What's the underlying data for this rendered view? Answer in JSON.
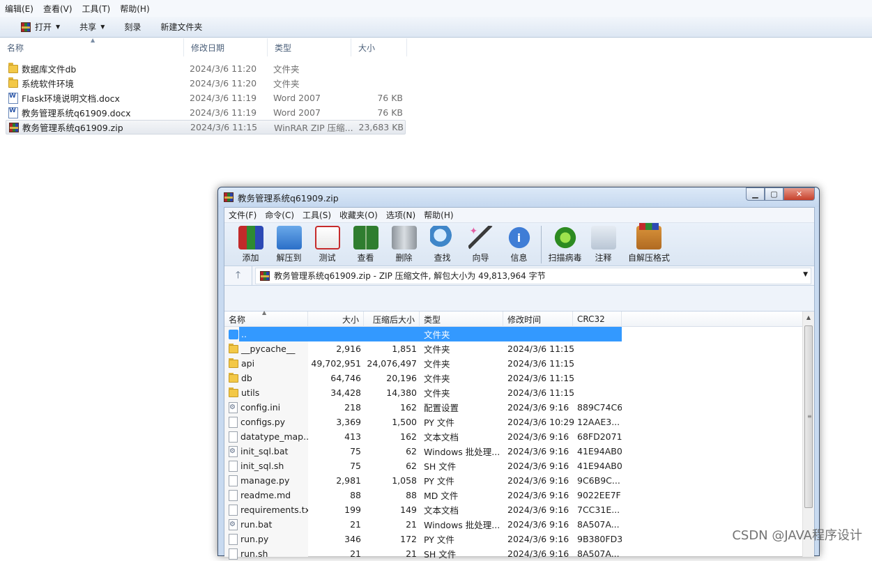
{
  "explorer": {
    "menu": [
      "编辑(E)",
      "查看(V)",
      "工具(T)",
      "帮助(H)"
    ],
    "toolbar": {
      "open": "打开",
      "share": "共享",
      "burn": "刻录",
      "new_folder": "新建文件夹"
    },
    "headers": {
      "name": "名称",
      "modified": "修改日期",
      "type": "类型",
      "size": "大小"
    },
    "rows": [
      {
        "icon": "folder-icon",
        "name": "数据库文件db",
        "date": "2024/3/6 11:20",
        "type": "文件夹",
        "size": ""
      },
      {
        "icon": "folder-icon",
        "name": "系统软件环境",
        "date": "2024/3/6 11:20",
        "type": "文件夹",
        "size": ""
      },
      {
        "icon": "word-doc-icon",
        "name": "Flask环境说明文档.docx",
        "date": "2024/3/6 11:19",
        "type": "Word 2007",
        "size": "76 KB"
      },
      {
        "icon": "word-doc-icon",
        "name": "教务管理系统q61909.docx",
        "date": "2024/3/6 11:19",
        "type": "Word 2007",
        "size": "76 KB"
      },
      {
        "icon": "winrar-archive-icon",
        "name": "教务管理系统q61909.zip",
        "date": "2024/3/6 11:15",
        "type": "WinRAR ZIP 压缩...",
        "size": "23,683 KB"
      }
    ],
    "selected_row": 4
  },
  "winrar": {
    "title": "教务管理系统q61909.zip",
    "menu": [
      "文件(F)",
      "命令(C)",
      "工具(S)",
      "收藏夹(O)",
      "选项(N)",
      "帮助(H)"
    ],
    "tools": [
      {
        "label": "添加",
        "icon": "add-archive-icon"
      },
      {
        "label": "解压到",
        "icon": "extract-to-icon"
      },
      {
        "label": "测试",
        "icon": "test-icon"
      },
      {
        "label": "查看",
        "icon": "view-book-icon"
      },
      {
        "label": "删除",
        "icon": "delete-trash-icon"
      },
      {
        "label": "查找",
        "icon": "find-magnifier-icon"
      },
      {
        "label": "向导",
        "icon": "wizard-icon"
      },
      {
        "label": "信息",
        "icon": "info-icon"
      },
      {
        "label": "扫描病毒",
        "icon": "virus-scan-icon"
      },
      {
        "label": "注释",
        "icon": "comment-icon"
      },
      {
        "label": "自解压格式",
        "icon": "sfx-icon"
      }
    ],
    "path": "教务管理系统q61909.zip - ZIP 压缩文件, 解包大小为 49,813,964 字节",
    "headers": {
      "name": "名称",
      "size": "大小",
      "packed": "压缩后大小",
      "type": "类型",
      "modified": "修改时间",
      "crc": "CRC32"
    },
    "rows": [
      {
        "icon": "up-folder-icon",
        "name": "..",
        "size": "",
        "packed": "",
        "type": "文件夹",
        "modified": "",
        "crc": ""
      },
      {
        "icon": "folder-icon",
        "name": "__pycache__",
        "size": "2,916",
        "packed": "1,851",
        "type": "文件夹",
        "modified": "2024/3/6 11:15",
        "crc": ""
      },
      {
        "icon": "folder-icon",
        "name": "api",
        "size": "49,702,951",
        "packed": "24,076,497",
        "type": "文件夹",
        "modified": "2024/3/6 11:15",
        "crc": ""
      },
      {
        "icon": "folder-icon",
        "name": "db",
        "size": "64,746",
        "packed": "20,196",
        "type": "文件夹",
        "modified": "2024/3/6 11:15",
        "crc": ""
      },
      {
        "icon": "folder-icon",
        "name": "utils",
        "size": "34,428",
        "packed": "14,380",
        "type": "文件夹",
        "modified": "2024/3/6 11:15",
        "crc": ""
      },
      {
        "icon": "settings-file-icon",
        "name": "config.ini",
        "size": "218",
        "packed": "162",
        "type": "配置设置",
        "modified": "2024/3/6 9:16",
        "crc": "889C74C6"
      },
      {
        "icon": "file-icon",
        "name": "configs.py",
        "size": "3,369",
        "packed": "1,500",
        "type": "PY 文件",
        "modified": "2024/3/6 10:29",
        "crc": "12AAE3..."
      },
      {
        "icon": "file-icon",
        "name": "datatype_map....",
        "size": "413",
        "packed": "162",
        "type": "文本文档",
        "modified": "2024/3/6 9:16",
        "crc": "68FD2071"
      },
      {
        "icon": "settings-file-icon",
        "name": "init_sql.bat",
        "size": "75",
        "packed": "62",
        "type": "Windows 批处理...",
        "modified": "2024/3/6 9:16",
        "crc": "41E94AB0"
      },
      {
        "icon": "file-icon",
        "name": "init_sql.sh",
        "size": "75",
        "packed": "62",
        "type": "SH 文件",
        "modified": "2024/3/6 9:16",
        "crc": "41E94AB0"
      },
      {
        "icon": "file-icon",
        "name": "manage.py",
        "size": "2,981",
        "packed": "1,058",
        "type": "PY 文件",
        "modified": "2024/3/6 9:16",
        "crc": "9C6B9C..."
      },
      {
        "icon": "file-icon",
        "name": "readme.md",
        "size": "88",
        "packed": "88",
        "type": "MD 文件",
        "modified": "2024/3/6 9:16",
        "crc": "9022EE7F"
      },
      {
        "icon": "file-icon",
        "name": "requirements.txt",
        "size": "199",
        "packed": "149",
        "type": "文本文档",
        "modified": "2024/3/6 9:16",
        "crc": "7CC31E..."
      },
      {
        "icon": "settings-file-icon",
        "name": "run.bat",
        "size": "21",
        "packed": "21",
        "type": "Windows 批处理...",
        "modified": "2024/3/6 9:16",
        "crc": "8A507A..."
      },
      {
        "icon": "file-icon",
        "name": "run.py",
        "size": "346",
        "packed": "172",
        "type": "PY 文件",
        "modified": "2024/3/6 9:16",
        "crc": "9B380FD3"
      },
      {
        "icon": "file-icon",
        "name": "run.sh",
        "size": "21",
        "packed": "21",
        "type": "SH 文件",
        "modified": "2024/3/6 9:16",
        "crc": "8A507A..."
      }
    ],
    "selected_row": 0
  },
  "watermark": "CSDN @JAVA程序设计"
}
